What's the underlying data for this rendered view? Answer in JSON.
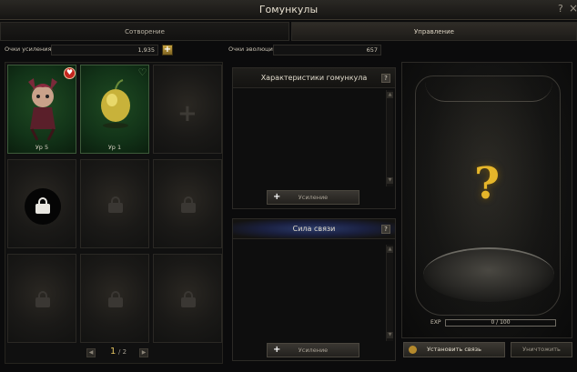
{
  "window": {
    "title": "Гомункулы",
    "help_label": "?",
    "close_label": "×"
  },
  "tabs": [
    {
      "label": "Сотворение"
    },
    {
      "label": "Управление"
    }
  ],
  "points": {
    "boost_label": "Очки усиления",
    "boost_value": "1,935",
    "evolution_label": "Очки эволюции",
    "evolution_value": "657",
    "add_label": "+"
  },
  "slots": [
    {
      "state": "homunculus",
      "level": "Ур 5"
    },
    {
      "state": "homunculus",
      "level": "Ур 1"
    },
    {
      "state": "add"
    },
    {
      "state": "locked-highlight"
    },
    {
      "state": "locked"
    },
    {
      "state": "locked"
    },
    {
      "state": "locked"
    },
    {
      "state": "locked"
    },
    {
      "state": "locked"
    }
  ],
  "pager": {
    "current": "1",
    "total": "/ 2",
    "prev": "◀",
    "next": "▶"
  },
  "stats_panel": {
    "title": "Характеристики гомункула",
    "button": "Усиление"
  },
  "bond_panel": {
    "title": "Сила связи",
    "button": "Усиление"
  },
  "preview": {
    "exp_label": "EXP",
    "exp_value": "0 / 100",
    "exp_progress": 0,
    "placeholder": "?",
    "bond_button": "Установить связь",
    "destroy_button": "Уничтожить"
  },
  "colors": {
    "accent": "#e6b62a",
    "heart": "#c3261f",
    "slot_green": "#1f4a22"
  }
}
